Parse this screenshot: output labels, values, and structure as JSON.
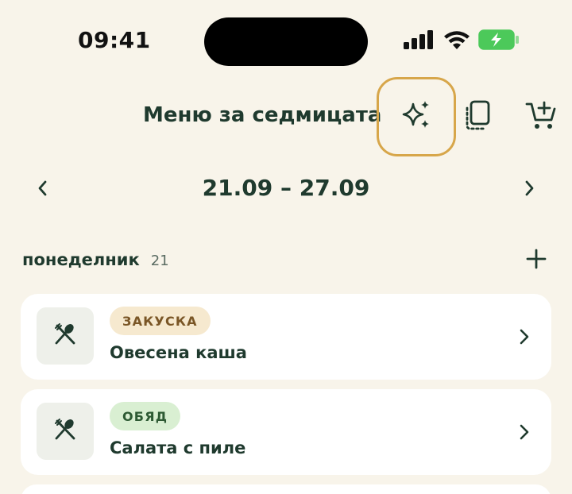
{
  "status_bar": {
    "time": "09:41",
    "icons": [
      "signal-icon",
      "wifi-icon",
      "battery-charging-icon"
    ]
  },
  "header": {
    "title": "Меню за седмицата",
    "actions": [
      "sparkles-icon",
      "copy-icon",
      "cart-add-icon"
    ],
    "highlight_color": "#d7a64a"
  },
  "week_nav": {
    "range": "21.09 – 27.09",
    "prev_icon": "chevron-left-icon",
    "next_icon": "chevron-right-icon"
  },
  "day": {
    "name": "понеделник",
    "number": "21",
    "add_icon": "plus-icon"
  },
  "meals": [
    {
      "tag": "ЗАКУСКА",
      "name": "Овесена каша",
      "tag_color": "#f6e9cf",
      "icon": "fork-spoon-icon"
    },
    {
      "tag": "ОБЯД",
      "name": "Салата с пиле",
      "tag_color": "#d9efd2",
      "icon": "fork-spoon-icon"
    }
  ],
  "colors": {
    "background": "#f8f4ea",
    "primary_text": "#1f3a2e",
    "card": "#ffffff",
    "battery": "#4cc95a"
  }
}
